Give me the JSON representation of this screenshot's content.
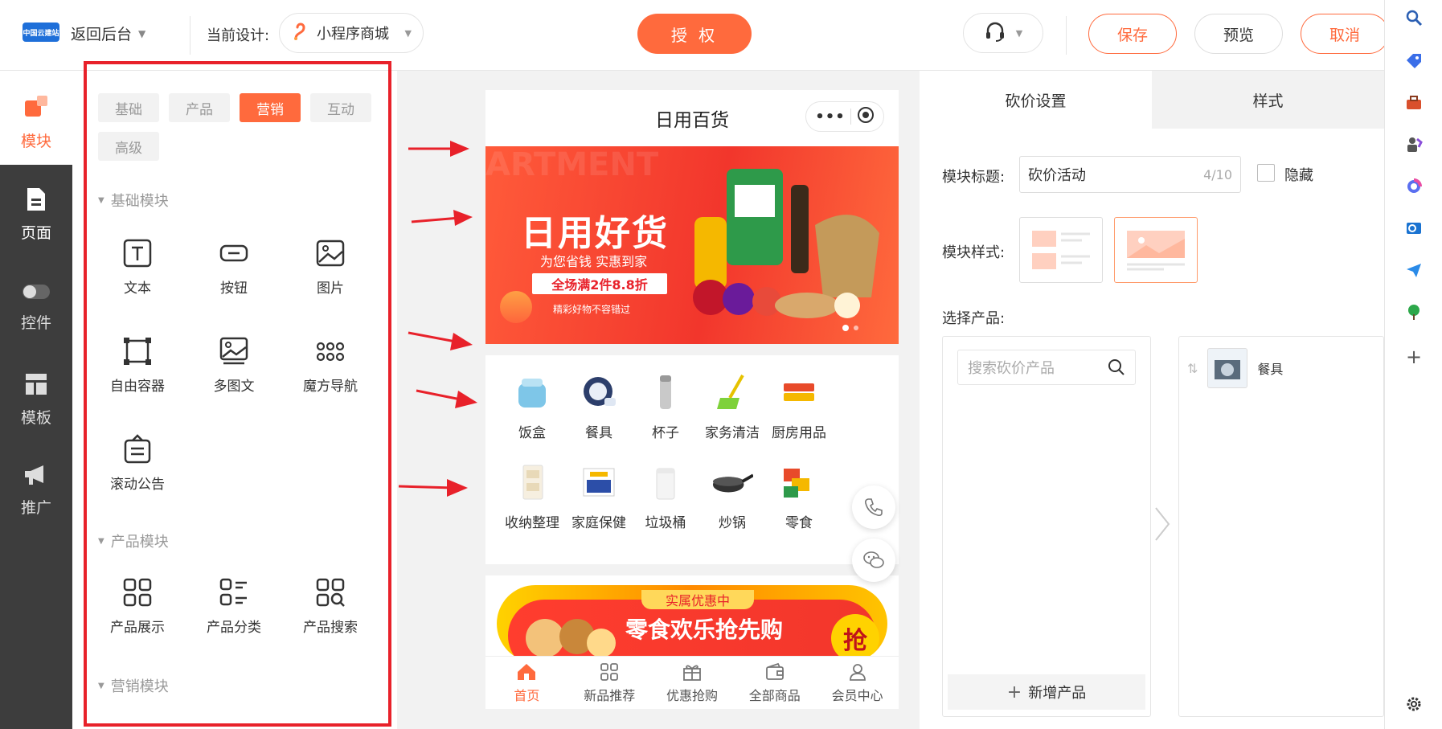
{
  "header": {
    "logo_text": "中国云建站",
    "back_label": "返回后台",
    "current_design_label": "当前设计:",
    "design_name": "小程序商城",
    "authorize_label": "授 权",
    "save_label": "保存",
    "preview_label": "预览",
    "cancel_label": "取消"
  },
  "left_nav": [
    {
      "label": "模块",
      "icon": "module-icon"
    },
    {
      "label": "页面",
      "icon": "page-icon"
    },
    {
      "label": "控件",
      "icon": "toggle-icon"
    },
    {
      "label": "模板",
      "icon": "template-icon"
    },
    {
      "label": "推广",
      "icon": "megaphone-icon"
    }
  ],
  "palette": {
    "tabs": [
      "基础",
      "产品",
      "营销",
      "互动",
      "高级"
    ],
    "active_tab": "营销",
    "sections": {
      "basic": {
        "title": "基础模块",
        "items": [
          "文本",
          "按钮",
          "图片",
          "自由容器",
          "多图文",
          "魔方导航",
          "滚动公告"
        ]
      },
      "product": {
        "title": "产品模块",
        "items": [
          "产品展示",
          "产品分类",
          "产品搜索"
        ]
      },
      "marketing": {
        "title": "营销模块"
      }
    }
  },
  "phone": {
    "title": "日用百货",
    "banner": {
      "watermark": "ARTMENT",
      "title": "日用好货",
      "subtitle": "为您省钱 实惠到家",
      "tag": "全场满2件8.8折",
      "note": "精彩好物不容错过"
    },
    "categories": [
      "饭盒",
      "餐具",
      "杯子",
      "家务清洁",
      "厨房用品",
      "收纳整理",
      "家庭保健",
      "垃圾桶",
      "炒锅",
      "零食"
    ],
    "promo": {
      "top": "实属优惠中",
      "text": "零食欢乐抢先购",
      "grab": "抢"
    },
    "tabbar": [
      {
        "label": "首页",
        "icon": "home-icon",
        "active": true
      },
      {
        "label": "新品推荐",
        "icon": "grid-icon"
      },
      {
        "label": "优惠抢购",
        "icon": "gift-icon"
      },
      {
        "label": "全部商品",
        "icon": "wallet-icon"
      },
      {
        "label": "会员中心",
        "icon": "user-icon"
      }
    ]
  },
  "settings": {
    "tabs": [
      "砍价设置",
      "样式"
    ],
    "module_title_label": "模块标题:",
    "module_title_value": "砍价活动",
    "module_title_count": "4/10",
    "hide_label": "隐藏",
    "module_style_label": "模块样式:",
    "select_product_label": "选择产品:",
    "search_placeholder": "搜索砍价产品",
    "add_product_label": "新增产品",
    "selected_product": "餐具"
  },
  "colors": {
    "accent": "#ff6a3d",
    "highlight_box": "#e8212a"
  }
}
